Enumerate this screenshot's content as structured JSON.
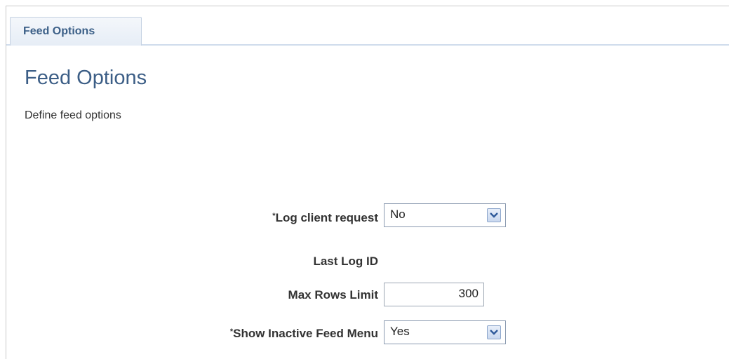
{
  "tabs": [
    {
      "label": "Feed Options"
    }
  ],
  "page": {
    "title": "Feed Options",
    "description": "Define feed options"
  },
  "form": {
    "log_client_request": {
      "required_marker": "*",
      "label": "Log client request",
      "value": "No"
    },
    "last_log_id": {
      "label": "Last Log ID"
    },
    "max_rows_limit": {
      "label": "Max Rows Limit",
      "value": "300"
    },
    "show_inactive_feed_menu": {
      "required_marker": "*",
      "label": "Show Inactive Feed Menu",
      "value": "Yes"
    }
  },
  "icons": {
    "dropdown": "chevron-down-icon"
  },
  "colors": {
    "title": "#3c5e86",
    "tab_text": "#3b5f87",
    "arrow": "#2f5a9a"
  }
}
